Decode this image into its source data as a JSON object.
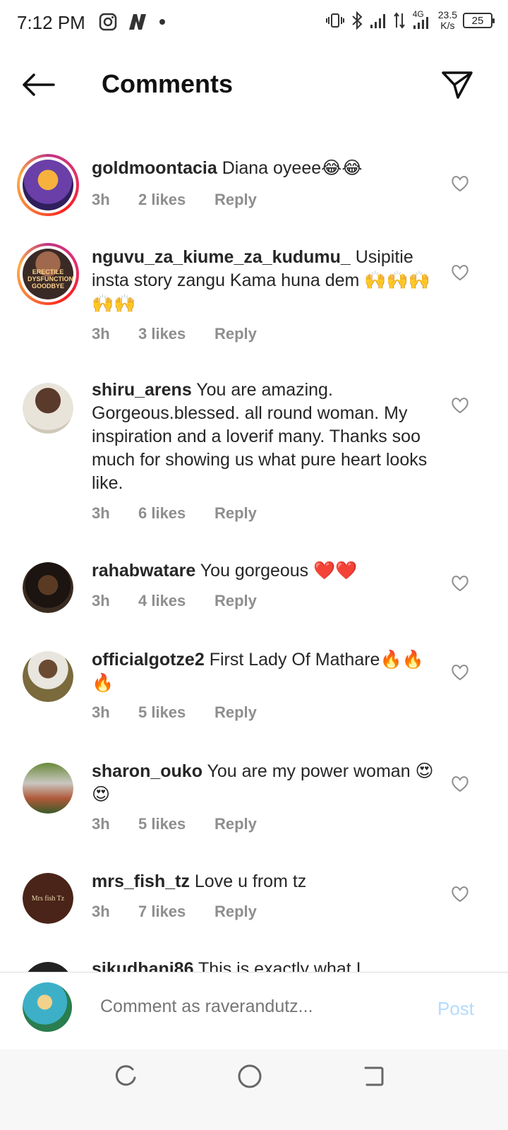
{
  "status_bar": {
    "time": "7:12 PM",
    "network": "4G",
    "speed_value": "23.5",
    "speed_unit": "K/s",
    "battery": "25"
  },
  "header": {
    "title": "Comments"
  },
  "comments": [
    {
      "username": "goldmoontacia",
      "text": "Diana oyeee😂😂",
      "time": "3h",
      "likes": "2 likes",
      "reply": "Reply",
      "story_ring": true
    },
    {
      "username": "nguvu_za_kiume_za_kudumu_",
      "text": "Usipitie insta story zangu Kama huna dem 🙌🙌🙌🙌🙌",
      "time": "3h",
      "likes": "3 likes",
      "reply": "Reply",
      "story_ring": true,
      "avatar_text": "ERECTILE DYSFUNCTION GOODBYE"
    },
    {
      "username": "shiru_arens",
      "text": "You are amazing. Gorgeous.blessed. all round woman. My inspiration and a loverif many. Thanks soo much for showing us what pure heart looks like.",
      "time": "3h",
      "likes": "6 likes",
      "reply": "Reply",
      "story_ring": false
    },
    {
      "username": "rahabwatare",
      "text": "You gorgeous ❤️❤️",
      "time": "3h",
      "likes": "4 likes",
      "reply": "Reply",
      "story_ring": false
    },
    {
      "username": "officialgotze2",
      "text": "First Lady Of Mathare🔥🔥🔥",
      "time": "3h",
      "likes": "5 likes",
      "reply": "Reply",
      "story_ring": false
    },
    {
      "username": "sharon_ouko",
      "text": "You are my power woman 😍😍",
      "time": "3h",
      "likes": "5 likes",
      "reply": "Reply",
      "story_ring": false
    },
    {
      "username": "mrs_fish_tz",
      "text": "Love u from tz",
      "time": "3h",
      "likes": "7 likes",
      "reply": "Reply",
      "story_ring": false,
      "avatar_text": "Mrs fish Tz"
    },
    {
      "username": "sikudhani86",
      "text": "This is exactly what I",
      "time": "",
      "likes": "",
      "reply": "",
      "story_ring": false
    }
  ],
  "composer": {
    "placeholder": "Comment as raverandutz...",
    "post_label": "Post"
  },
  "colors": {
    "meta_gray": "#8e8e8e",
    "post_disabled": "#b3dbff",
    "text": "#262626"
  },
  "icons": [
    "back-arrow-icon",
    "direct-message-icon",
    "heart-icon",
    "recents-icon",
    "home-icon",
    "back-nav-icon"
  ]
}
